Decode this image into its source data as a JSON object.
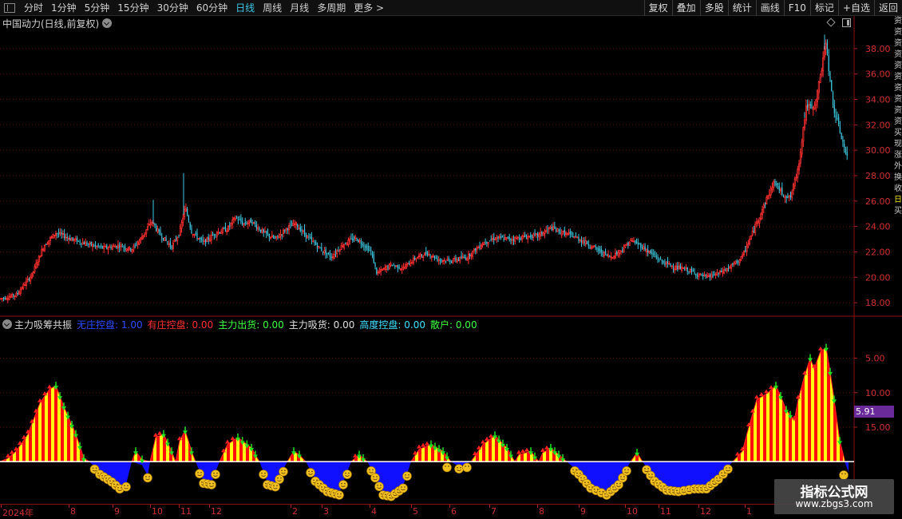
{
  "toolbar": {
    "tabs": [
      "分时",
      "1分钟",
      "5分钟",
      "15分钟",
      "30分钟",
      "60分钟",
      "日线",
      "周线",
      "月线",
      "多周期",
      "更多 >"
    ],
    "active_tab": "日线",
    "right_buttons": [
      "复权",
      "叠加",
      "多股",
      "统计",
      "画线",
      "F10",
      "标记",
      "+自选",
      "返回"
    ]
  },
  "main": {
    "title": "中国动力(日线,前复权)",
    "price_labels": [
      "38.00",
      "36.00",
      "34.00",
      "32.00",
      "30.00",
      "28.00",
      "26.00",
      "24.00",
      "22.00",
      "20.00",
      "18.00"
    ]
  },
  "sub": {
    "name": "主力吸筹共振",
    "legend": [
      {
        "label": "无庄控盘:",
        "value": "1.00",
        "color": "#2a4bff"
      },
      {
        "label": "有庄控盘:",
        "value": "0.00",
        "color": "#ff3030"
      },
      {
        "label": "主力出货:",
        "value": "0.00",
        "color": "#40ff40"
      },
      {
        "label": "主力吸货:",
        "value": "0.00",
        "color": "#e0e0e0"
      },
      {
        "label": "高度控盘:",
        "value": "0.00",
        "color": "#40e0ff"
      },
      {
        "label": "散户:",
        "value": "0.00",
        "color": "#40ff40"
      }
    ],
    "axis_labels": [
      "15.00",
      "10.00",
      "5.00"
    ],
    "current_value": "5.91"
  },
  "date_axis": [
    "2024年",
    "8",
    "9",
    "10",
    "11",
    "12",
    "2",
    "3",
    "4",
    "5",
    "6",
    "7",
    "8",
    "9",
    "10",
    "11",
    "12",
    "1"
  ],
  "right_strip": [
    "资",
    "资",
    "资",
    "资",
    "资",
    "资",
    "资",
    "资",
    "资",
    "资",
    "买",
    "现",
    "涨",
    "外",
    "换",
    "收",
    "",
    "",
    "",
    "",
    "",
    "",
    "",
    "",
    "",
    "日",
    "买"
  ],
  "watermark": {
    "line1": "指标公式网",
    "line2": "www.zbgs3.com"
  },
  "chart_data": [
    {
      "type": "candlestick",
      "title": "中国动力(日线,前复权)",
      "ylim": [
        17.0,
        39.5
      ],
      "yticks": [
        18,
        20,
        22,
        24,
        26,
        28,
        30,
        32,
        34,
        36,
        38
      ],
      "close_path": [
        [
          0,
          18.3
        ],
        [
          20,
          18.6
        ],
        [
          40,
          20.2
        ],
        [
          55,
          22.5
        ],
        [
          70,
          23.5
        ],
        [
          90,
          23.0
        ],
        [
          110,
          22.6
        ],
        [
          130,
          22.3
        ],
        [
          150,
          22.5
        ],
        [
          165,
          22.2
        ],
        [
          175,
          22.9
        ],
        [
          190,
          24.4
        ],
        [
          200,
          23.4
        ],
        [
          215,
          22.4
        ],
        [
          225,
          23.5
        ],
        [
          232,
          25.5
        ],
        [
          240,
          23.6
        ],
        [
          255,
          22.7
        ],
        [
          270,
          23.5
        ],
        [
          285,
          23.8
        ],
        [
          295,
          24.7
        ],
        [
          305,
          24.2
        ],
        [
          315,
          24.4
        ],
        [
          330,
          23.5
        ],
        [
          345,
          23.0
        ],
        [
          360,
          23.9
        ],
        [
          370,
          24.2
        ],
        [
          385,
          23.2
        ],
        [
          400,
          22.3
        ],
        [
          415,
          21.6
        ],
        [
          430,
          22.6
        ],
        [
          445,
          23.1
        ],
        [
          455,
          22.6
        ],
        [
          465,
          22.0
        ],
        [
          472,
          20.3
        ],
        [
          480,
          20.6
        ],
        [
          490,
          21.0
        ],
        [
          505,
          20.7
        ],
        [
          520,
          21.5
        ],
        [
          535,
          21.9
        ],
        [
          550,
          21.4
        ],
        [
          565,
          21.3
        ],
        [
          585,
          21.6
        ],
        [
          605,
          22.7
        ],
        [
          620,
          23.1
        ],
        [
          640,
          23.0
        ],
        [
          660,
          23.2
        ],
        [
          675,
          23.3
        ],
        [
          690,
          23.9
        ],
        [
          705,
          23.5
        ],
        [
          720,
          23.2
        ],
        [
          735,
          22.7
        ],
        [
          750,
          22.1
        ],
        [
          765,
          21.6
        ],
        [
          780,
          22.2
        ],
        [
          790,
          22.9
        ],
        [
          800,
          22.6
        ],
        [
          815,
          21.9
        ],
        [
          830,
          21.2
        ],
        [
          845,
          20.8
        ],
        [
          860,
          20.6
        ],
        [
          875,
          20.2
        ],
        [
          885,
          20.0
        ],
        [
          900,
          20.3
        ],
        [
          915,
          20.8
        ],
        [
          930,
          21.6
        ],
        [
          940,
          23.1
        ],
        [
          950,
          24.6
        ],
        [
          960,
          26.1
        ],
        [
          970,
          27.5
        ],
        [
          980,
          26.6
        ],
        [
          990,
          26.2
        ],
        [
          1000,
          28.6
        ],
        [
          1010,
          33.5
        ],
        [
          1020,
          33.2
        ],
        [
          1030,
          36.6
        ],
        [
          1035,
          38.8
        ],
        [
          1040,
          35.2
        ],
        [
          1045,
          33.1
        ],
        [
          1050,
          32.0
        ],
        [
          1055,
          30.8
        ],
        [
          1062,
          29.2
        ]
      ],
      "ohlc_bars": 600
    },
    {
      "type": "area",
      "title": "主力吸筹共振",
      "ylim": [
        -6,
        19
      ],
      "yticks": [
        5,
        10,
        15
      ],
      "baseline": 0,
      "series": [
        {
          "name": "有庄控盘",
          "points": [
            [
              0,
              0.0
            ],
            [
              10,
              0.5
            ],
            [
              20,
              1.5
            ],
            [
              35,
              4.0
            ],
            [
              50,
              8.5
            ],
            [
              62,
              10.5
            ],
            [
              70,
              11.0
            ],
            [
              80,
              8.0
            ],
            [
              95,
              4.0
            ],
            [
              105,
              0.5
            ],
            [
              112,
              0.0
            ],
            [
              165,
              0.0
            ],
            [
              170,
              1.5
            ],
            [
              178,
              0.3
            ],
            [
              188,
              0.0
            ],
            [
              195,
              3.5
            ],
            [
              205,
              4.0
            ],
            [
              215,
              1.5
            ],
            [
              220,
              0.0
            ],
            [
              225,
              3.0
            ],
            [
              232,
              4.5
            ],
            [
              240,
              1.5
            ],
            [
              245,
              0.0
            ],
            [
              275,
              0.0
            ],
            [
              285,
              2.5
            ],
            [
              298,
              3.5
            ],
            [
              315,
              2.0
            ],
            [
              325,
              0.0
            ],
            [
              360,
              0.0
            ],
            [
              368,
              1.5
            ],
            [
              375,
              1.0
            ],
            [
              383,
              0.0
            ],
            [
              440,
              0.0
            ],
            [
              450,
              1.0
            ],
            [
              460,
              0.0
            ],
            [
              515,
              0.0
            ],
            [
              525,
              1.8
            ],
            [
              540,
              2.5
            ],
            [
              555,
              1.5
            ],
            [
              565,
              0.0
            ],
            [
              590,
              0.0
            ],
            [
              605,
              2.5
            ],
            [
              620,
              3.8
            ],
            [
              635,
              2.0
            ],
            [
              645,
              0.0
            ],
            [
              650,
              1.0
            ],
            [
              665,
              1.5
            ],
            [
              675,
              0.0
            ],
            [
              680,
              1.3
            ],
            [
              690,
              2.0
            ],
            [
              700,
              1.0
            ],
            [
              710,
              0.0
            ],
            [
              790,
              0.0
            ],
            [
              798,
              1.3
            ],
            [
              805,
              0.0
            ],
            [
              918,
              0.0
            ],
            [
              930,
              1.5
            ],
            [
              938,
              5.0
            ],
            [
              948,
              9.0
            ],
            [
              960,
              9.8
            ],
            [
              972,
              11.0
            ],
            [
              978,
              9.5
            ],
            [
              985,
              7.5
            ],
            [
              995,
              6.0
            ],
            [
              1000,
              9.0
            ],
            [
              1008,
              12.5
            ],
            [
              1015,
              15.0
            ],
            [
              1020,
              13.5
            ],
            [
              1028,
              16.0
            ],
            [
              1035,
              16.5
            ],
            [
              1040,
              13.0
            ],
            [
              1045,
              9.0
            ],
            [
              1052,
              3.0
            ],
            [
              1058,
              0.3
            ]
          ]
        },
        {
          "name": "无庄控盘",
          "points": [
            [
              112,
              0.0
            ],
            [
              125,
              -1.5
            ],
            [
              140,
              -2.6
            ],
            [
              150,
              -3.6
            ],
            [
              158,
              -3.3
            ],
            [
              165,
              0.0
            ],
            [
              178,
              -0.5
            ],
            [
              185,
              -2.0
            ],
            [
              188,
              0.0
            ],
            [
              245,
              0.0
            ],
            [
              255,
              -2.8
            ],
            [
              265,
              -3.0
            ],
            [
              275,
              0.0
            ],
            [
              325,
              0.0
            ],
            [
              335,
              -3.0
            ],
            [
              345,
              -3.3
            ],
            [
              360,
              0.0
            ],
            [
              383,
              0.0
            ],
            [
              395,
              -2.5
            ],
            [
              410,
              -4.0
            ],
            [
              425,
              -4.5
            ],
            [
              440,
              0.0
            ],
            [
              460,
              0.0
            ],
            [
              470,
              -2.0
            ],
            [
              480,
              -4.5
            ],
            [
              490,
              -4.7
            ],
            [
              505,
              -3.5
            ],
            [
              515,
              0.0
            ],
            [
              565,
              0.0
            ],
            [
              575,
              -0.7
            ],
            [
              590,
              0.0
            ],
            [
              710,
              0.0
            ],
            [
              725,
              -1.5
            ],
            [
              740,
              -3.5
            ],
            [
              760,
              -4.5
            ],
            [
              775,
              -3.0
            ],
            [
              790,
              0.0
            ],
            [
              805,
              0.0
            ],
            [
              820,
              -2.5
            ],
            [
              835,
              -3.8
            ],
            [
              850,
              -4.0
            ],
            [
              870,
              -3.6
            ],
            [
              885,
              -3.6
            ],
            [
              900,
              -2.2
            ],
            [
              918,
              0.0
            ],
            [
              1058,
              0.0
            ],
            [
              1063,
              -1.5
            ]
          ]
        }
      ]
    }
  ]
}
